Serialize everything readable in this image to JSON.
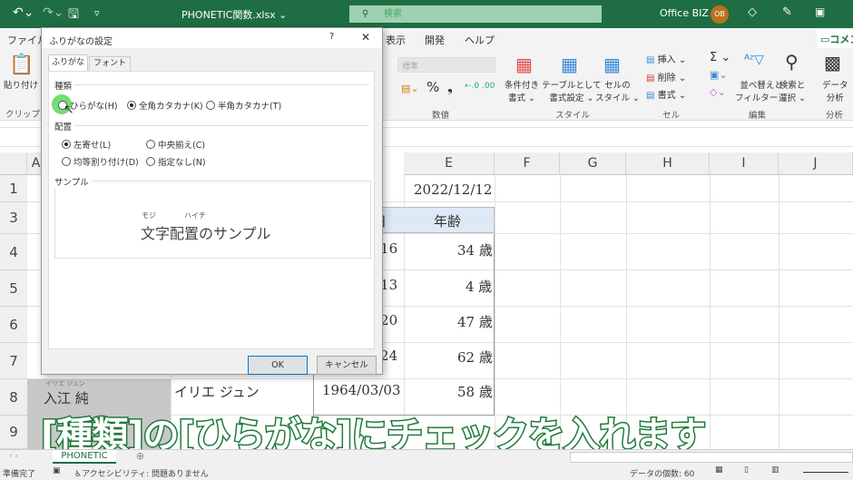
{
  "titlebar": {
    "filename": "PHONETIC関数.xlsx ⌄",
    "search_placeholder": "検索",
    "user": "Office BIZ",
    "avatar": "OB",
    "undo": "↶⌄",
    "redo": "↷⌄",
    "save": "🖫",
    "qat": "▿"
  },
  "menu": {
    "file": "ファイル",
    "view": "表示",
    "dev": "開発",
    "help": "ヘルプ",
    "comment": "コメント"
  },
  "ribbon": {
    "paste": "貼り付け",
    "clipboard": "クリップボード",
    "number_format": "標準",
    "percent": "%",
    "comma": "❟",
    "number_group": "数値",
    "cond_format": "条件付き\n書式 ⌄",
    "table_format": "テーブルとして\n書式設定 ⌄",
    "cell_style": "セルの\nスタイル ⌄",
    "style_group": "スタイル",
    "insert": "挿入 ⌄",
    "delete": "削除 ⌄",
    "format": "書式 ⌄",
    "cell_group": "セル",
    "sum": "Σ ⌄",
    "sort": "並べ替えと\nフィルター ⌄",
    "find": "検索と\n選択 ⌄",
    "edit_group": "編集",
    "data_analysis": "データ\n分析",
    "analysis_group": "分析"
  },
  "columns": [
    "A",
    "E",
    "F",
    "G",
    "H",
    "I",
    "J"
  ],
  "rows": [
    "1",
    "3",
    "4",
    "5",
    "6",
    "7",
    "8",
    "9"
  ],
  "cells": {
    "e1": "2022/12/12",
    "e3": "年齢",
    "d3_partial": "日",
    "d4": "/16",
    "e4": "34 歳",
    "d5": "/13",
    "e5": "4 歳",
    "d6": "/20",
    "e6": "47 歳",
    "d7": "/24",
    "e7": "62 歳",
    "b8_ruby": "イリエ ジュン",
    "b8": "入江 純",
    "c8": "イリエ ジュン",
    "d8": "1964/03/03",
    "e8": "58 歳"
  },
  "dialog": {
    "title": "ふりがなの設定",
    "help": "?",
    "close": "✕",
    "tabs": [
      "ふりがな",
      "フォント"
    ],
    "type_label": "種類",
    "type_options": [
      {
        "label": "ひらがな(H)",
        "selected": false
      },
      {
        "label": "全角カタカナ(K)",
        "selected": true
      },
      {
        "label": "半角カタカナ(T)",
        "selected": false
      }
    ],
    "align_label": "配置",
    "align_options": [
      {
        "label": "左寄せ(L)",
        "selected": true
      },
      {
        "label": "中央揃え(C)",
        "selected": false
      },
      {
        "label": "均等割り付け(D)",
        "selected": false
      },
      {
        "label": "指定なし(N)",
        "selected": false
      }
    ],
    "sample_label": "サンプル",
    "sample_ruby_1": "モジ",
    "sample_ruby_2": "ハイチ",
    "sample_text": "文字配置のサンプル",
    "ok": "OK",
    "cancel": "キャンセル"
  },
  "caption": "[種類]の[ひらがな]にチェックを入れます",
  "sheet_tab": "PHONETIC",
  "add_sheet": "⊕",
  "status": {
    "ready": "準備完了",
    "accessibility": "アクセシビリティ: 問題ありません",
    "count": "データの個数: 60"
  },
  "colors": {
    "excel_green": "#1f6e43",
    "click_highlight": "#5cd65c",
    "header_fill": "#dde9f5"
  }
}
